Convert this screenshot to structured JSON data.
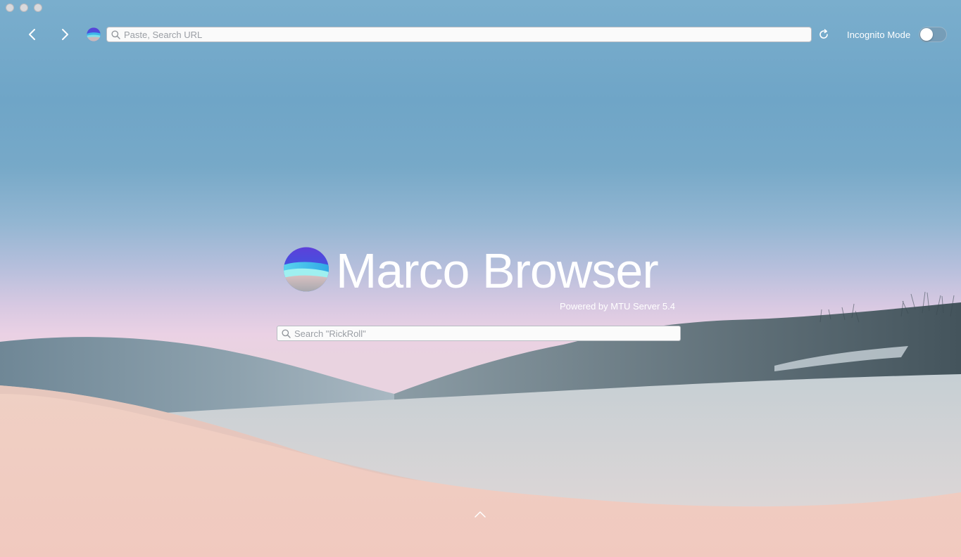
{
  "toolbar": {
    "url_placeholder": "Paste, Search URL",
    "incognito_label": "Incognito Mode",
    "incognito_enabled": false
  },
  "hero": {
    "title": "Marco Browser",
    "subtitle": "Powered by MTU Server 5.4",
    "search_placeholder": "Search \"RickRoll\""
  },
  "icons": {
    "back": "chevron-left-icon",
    "forward": "chevron-right-icon",
    "site": "marco-logo-icon",
    "search": "search-icon",
    "reload": "reload-icon",
    "expand": "chevron-up-icon"
  },
  "colors": {
    "sky_top": "#7aaecd",
    "horizon": "#ead1e4",
    "sand": "#f0cdc2",
    "text_light": "#ffffff"
  }
}
